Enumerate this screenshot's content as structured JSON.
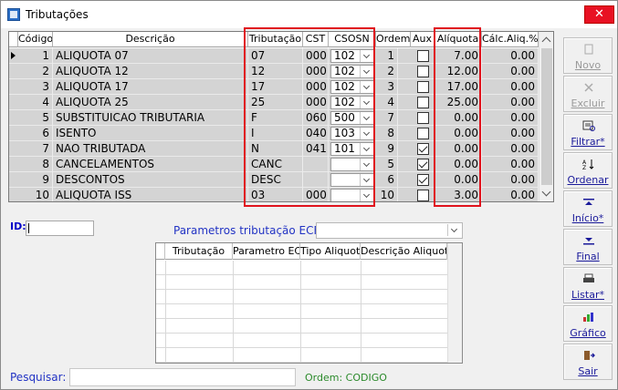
{
  "window": {
    "title": "Tributações",
    "close_glyph": "✕"
  },
  "grid": {
    "columns": [
      "Código",
      "Descrição",
      "Tributação",
      "CST",
      "CSOSN",
      "Ordem",
      "Aux",
      "Alíquota",
      "Cálc.Aliq.%"
    ],
    "rows": [
      {
        "codigo": "1",
        "descricao": "ALIQUOTA 07",
        "tributacao": "07",
        "cst": "000",
        "csosn": "102",
        "ordem": "1",
        "aux": false,
        "aliquota": "7.00",
        "calc": "0.00"
      },
      {
        "codigo": "2",
        "descricao": "ALIQUOTA 12",
        "tributacao": "12",
        "cst": "000",
        "csosn": "102",
        "ordem": "2",
        "aux": false,
        "aliquota": "12.00",
        "calc": "0.00"
      },
      {
        "codigo": "3",
        "descricao": "ALIQUOTA 17",
        "tributacao": "17",
        "cst": "000",
        "csosn": "102",
        "ordem": "3",
        "aux": false,
        "aliquota": "17.00",
        "calc": "0.00"
      },
      {
        "codigo": "4",
        "descricao": "ALIQUOTA 25",
        "tributacao": "25",
        "cst": "000",
        "csosn": "102",
        "ordem": "4",
        "aux": false,
        "aliquota": "25.00",
        "calc": "0.00"
      },
      {
        "codigo": "5",
        "descricao": "SUBSTITUICAO TRIBUTARIA",
        "tributacao": "F",
        "cst": "060",
        "csosn": "500",
        "ordem": "7",
        "aux": false,
        "aliquota": "0.00",
        "calc": "0.00"
      },
      {
        "codigo": "6",
        "descricao": "ISENTO",
        "tributacao": "I",
        "cst": "040",
        "csosn": "103",
        "ordem": "8",
        "aux": false,
        "aliquota": "0.00",
        "calc": "0.00"
      },
      {
        "codigo": "7",
        "descricao": "NAO TRIBUTADA",
        "tributacao": "N",
        "cst": "041",
        "csosn": "101",
        "ordem": "9",
        "aux": true,
        "aliquota": "0.00",
        "calc": "0.00"
      },
      {
        "codigo": "8",
        "descricao": "CANCELAMENTOS",
        "tributacao": "CANC",
        "cst": "",
        "csosn": "",
        "ordem": "5",
        "aux": true,
        "aliquota": "0.00",
        "calc": "0.00"
      },
      {
        "codigo": "9",
        "descricao": "DESCONTOS",
        "tributacao": "DESC",
        "cst": "",
        "csosn": "",
        "ordem": "6",
        "aux": true,
        "aliquota": "0.00",
        "calc": "0.00"
      },
      {
        "codigo": "10",
        "descricao": "ALIQUOTA ISS",
        "tributacao": "03",
        "cst": "000",
        "csosn": "",
        "ordem": "10",
        "aux": false,
        "aliquota": "3.00",
        "calc": "0.00"
      }
    ]
  },
  "id_field": {
    "label": "ID:",
    "value": ""
  },
  "ecf": {
    "label": "Parametros tributação ECF:",
    "value": ""
  },
  "sub_grid": {
    "columns": [
      "Tributação",
      "Parametro ECF",
      "Tipo Aliquota",
      "Descrição Aliquota"
    ]
  },
  "search": {
    "label": "Pesquisar:",
    "value": ""
  },
  "order_text": "Ordem: CODIGO",
  "toolbar": [
    {
      "label": "Novo",
      "icon": "new-icon",
      "enabled": false
    },
    {
      "label": "Excluir",
      "icon": "delete-icon",
      "enabled": false
    },
    {
      "label": "Filtrar*",
      "icon": "filter-icon",
      "enabled": true
    },
    {
      "label": "Ordenar",
      "icon": "sort-az-icon",
      "enabled": true
    },
    {
      "label": "Início*",
      "icon": "first-record-icon",
      "enabled": true
    },
    {
      "label": "Final",
      "icon": "last-record-icon",
      "enabled": true
    },
    {
      "label": "Listar*",
      "icon": "printer-icon",
      "enabled": true
    },
    {
      "label": "Gráfico",
      "icon": "bar-chart-icon",
      "enabled": true
    },
    {
      "label": "Sair",
      "icon": "exit-door-icon",
      "enabled": true
    }
  ],
  "colors": {
    "highlight_box": "#e0131d",
    "link_blue": "#2233c4",
    "order_green": "#2b8a2b",
    "row_bg": "#d4d4d4"
  }
}
